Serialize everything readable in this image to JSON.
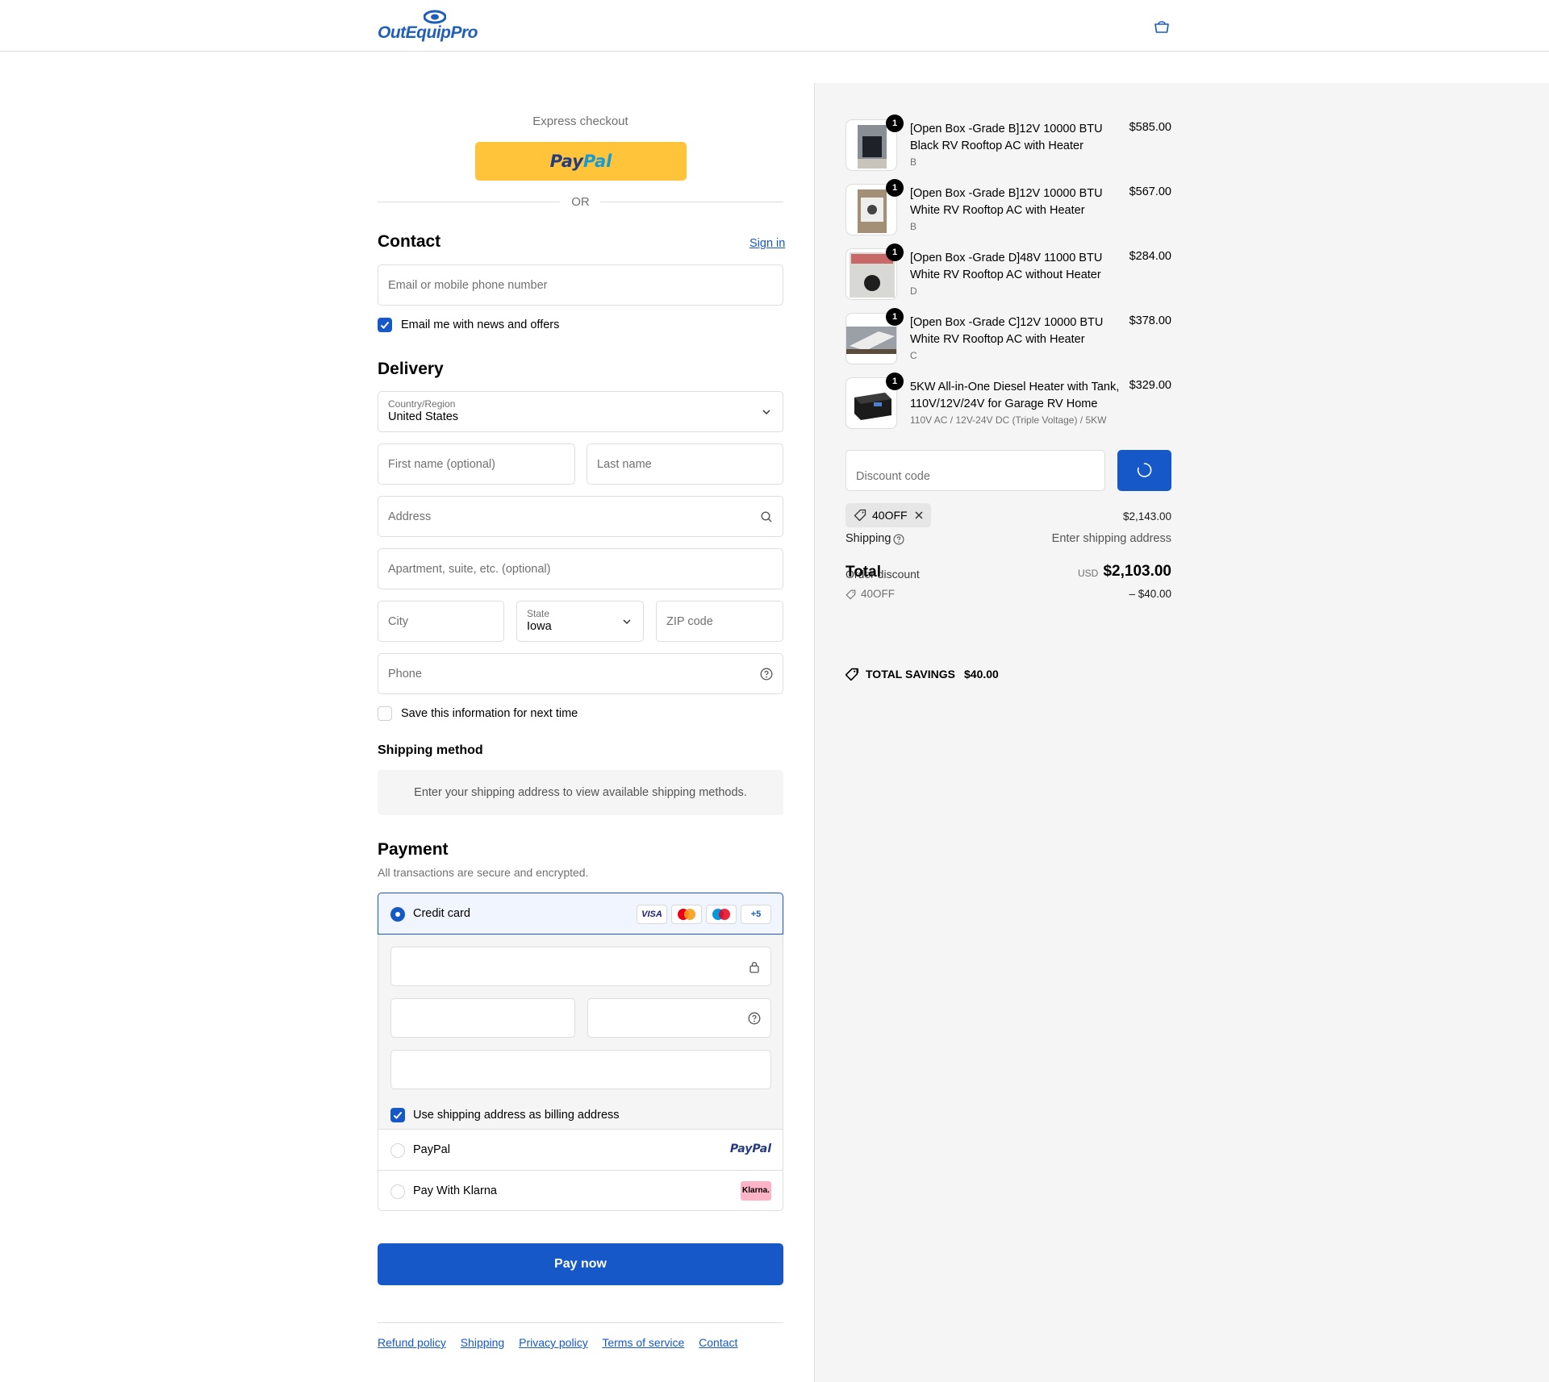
{
  "header": {
    "brand": "OutEquipPro",
    "cart_icon": "shopping-bag-icon"
  },
  "express": {
    "label": "Express checkout",
    "paypal_pay": "Pay",
    "paypal_pal": "Pal",
    "or": "OR"
  },
  "contact": {
    "title": "Contact",
    "sign_in": "Sign in",
    "email_placeholder": "Email or mobile phone number",
    "news_label": "Email me with news and offers",
    "news_checked": true
  },
  "delivery": {
    "title": "Delivery",
    "country_label": "Country/Region",
    "country_value": "United States",
    "first_name_placeholder": "First name (optional)",
    "last_name_placeholder": "Last name",
    "address_placeholder": "Address",
    "apartment_placeholder": "Apartment, suite, etc. (optional)",
    "city_placeholder": "City",
    "state_label": "State",
    "state_value": "Iowa",
    "zip_placeholder": "ZIP code",
    "phone_placeholder": "Phone",
    "save_label": "Save this information for next time"
  },
  "shipping_method": {
    "title": "Shipping method",
    "message": "Enter your shipping address to view available shipping methods."
  },
  "payment": {
    "title": "Payment",
    "subtitle": "All transactions are secure and encrypted.",
    "credit_card_label": "Credit card",
    "card_brands": [
      "VISA",
      "mastercard",
      "maestro",
      "+5"
    ],
    "billing_label": "Use shipping address as billing address",
    "paypal_label": "PayPal",
    "paypal_logo": "PayPal",
    "klarna_label": "Pay With Klarna",
    "klarna_logo": "Klarna."
  },
  "pay_now": "Pay now",
  "footer": [
    "Refund policy",
    "Shipping",
    "Privacy policy",
    "Terms of service",
    "Contact"
  ],
  "summary": {
    "items": [
      {
        "name": "[Open Box -Grade B]12V 10000 BTU Black RV Rooftop AC with Heater",
        "variant": "B",
        "price": "$585.00",
        "qty": "1"
      },
      {
        "name": "[Open Box -Grade B]12V 10000 BTU White RV Rooftop AC with Heater",
        "variant": "B",
        "price": "$567.00",
        "qty": "1"
      },
      {
        "name": "[Open Box -Grade D]48V 11000 BTU White RV Rooftop AC without Heater",
        "variant": "D",
        "price": "$284.00",
        "qty": "1"
      },
      {
        "name": "[Open Box -Grade C]12V 10000 BTU White RV Rooftop AC with Heater",
        "variant": "C",
        "price": "$378.00",
        "qty": "1"
      },
      {
        "name": "5KW All-in-One Diesel Heater with Tank, 110V/12V/24V for Garage RV Home",
        "variant": "110V AC / 12V-24V DC (Triple Voltage) / 5KW",
        "price": "$329.00",
        "qty": "1"
      }
    ],
    "discount_placeholder": "Discount code",
    "applied_code": "40OFF",
    "subtotal": "$2,143.00",
    "shipping_label": "Shipping",
    "shipping_value": "Enter shipping address",
    "total_label": "Total",
    "order_discount_label": "Order discount",
    "currency": "USD",
    "total_value": "$2,103.00",
    "discount_code": "40OFF",
    "discount_value": "– $40.00",
    "savings_label": "TOTAL SAVINGS",
    "savings_value": "$40.00"
  },
  "colors": {
    "accent": "#1658c8",
    "paypal_yellow": "#ffc439",
    "summary_bg": "#f5f5f5"
  }
}
